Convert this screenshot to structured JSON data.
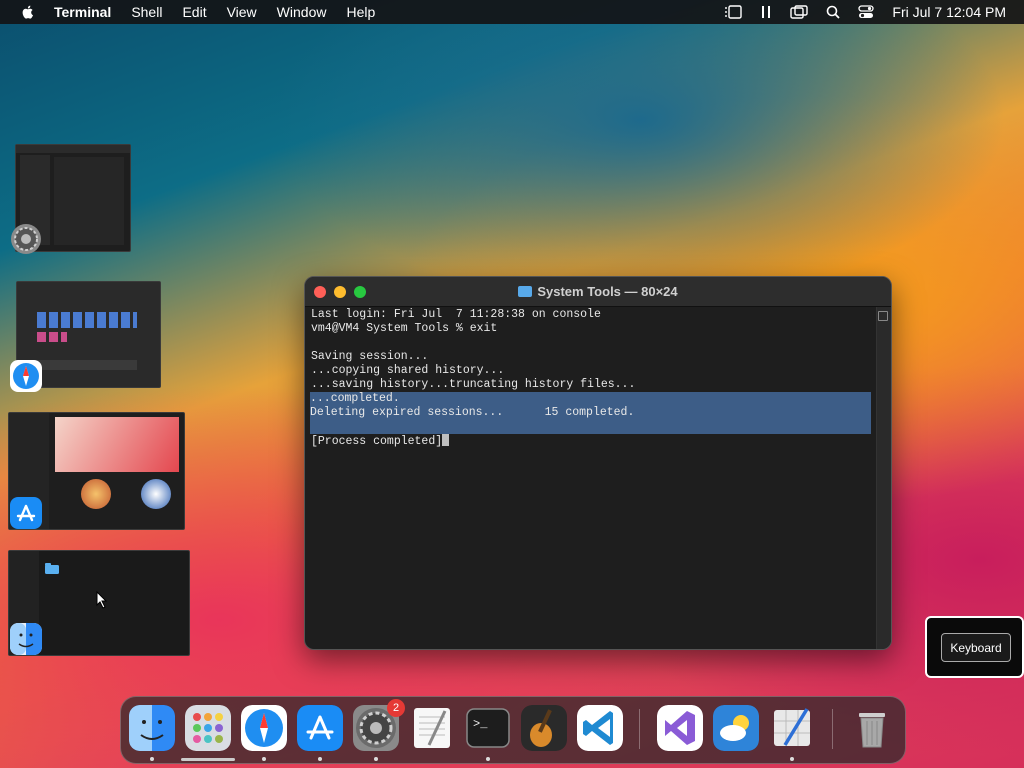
{
  "menubar": {
    "app_name": "Terminal",
    "menus": [
      "Shell",
      "Edit",
      "View",
      "Window",
      "Help"
    ],
    "clock": "Fri Jul 7  12:04 PM"
  },
  "terminal": {
    "title": "System Tools — 80×24",
    "lines": [
      "Last login: Fri Jul  7 11:28:38 on console",
      "vm4@VM4 System Tools % exit",
      "",
      "Saving session...",
      "...copying shared history...",
      "...saving history...truncating history files...",
      "...completed.",
      "Deleting expired sessions...      15 completed.",
      "",
      "[Process completed]"
    ]
  },
  "keyboard_button": {
    "label": "Keyboard"
  },
  "dock": {
    "items": [
      {
        "name": "finder-icon",
        "running": true
      },
      {
        "name": "launchpad-icon",
        "running": false
      },
      {
        "name": "safari-icon",
        "running": true
      },
      {
        "name": "app-store-icon",
        "running": true
      },
      {
        "name": "system-settings-icon",
        "running": true,
        "badge": "2"
      },
      {
        "name": "textedit-icon",
        "running": false
      },
      {
        "name": "terminal-icon",
        "running": true
      },
      {
        "name": "garageband-icon",
        "running": false
      },
      {
        "name": "vscode-icon",
        "running": false
      },
      {
        "name": "visual-studio-icon",
        "running": false
      },
      {
        "name": "weather-icon",
        "running": false
      },
      {
        "name": "script-editor-icon",
        "running": true
      },
      {
        "name": "trash-icon",
        "running": false
      }
    ]
  },
  "stage_manager": {
    "windows": [
      "system-settings-window",
      "safari-window",
      "app-store-window",
      "finder-window"
    ]
  }
}
